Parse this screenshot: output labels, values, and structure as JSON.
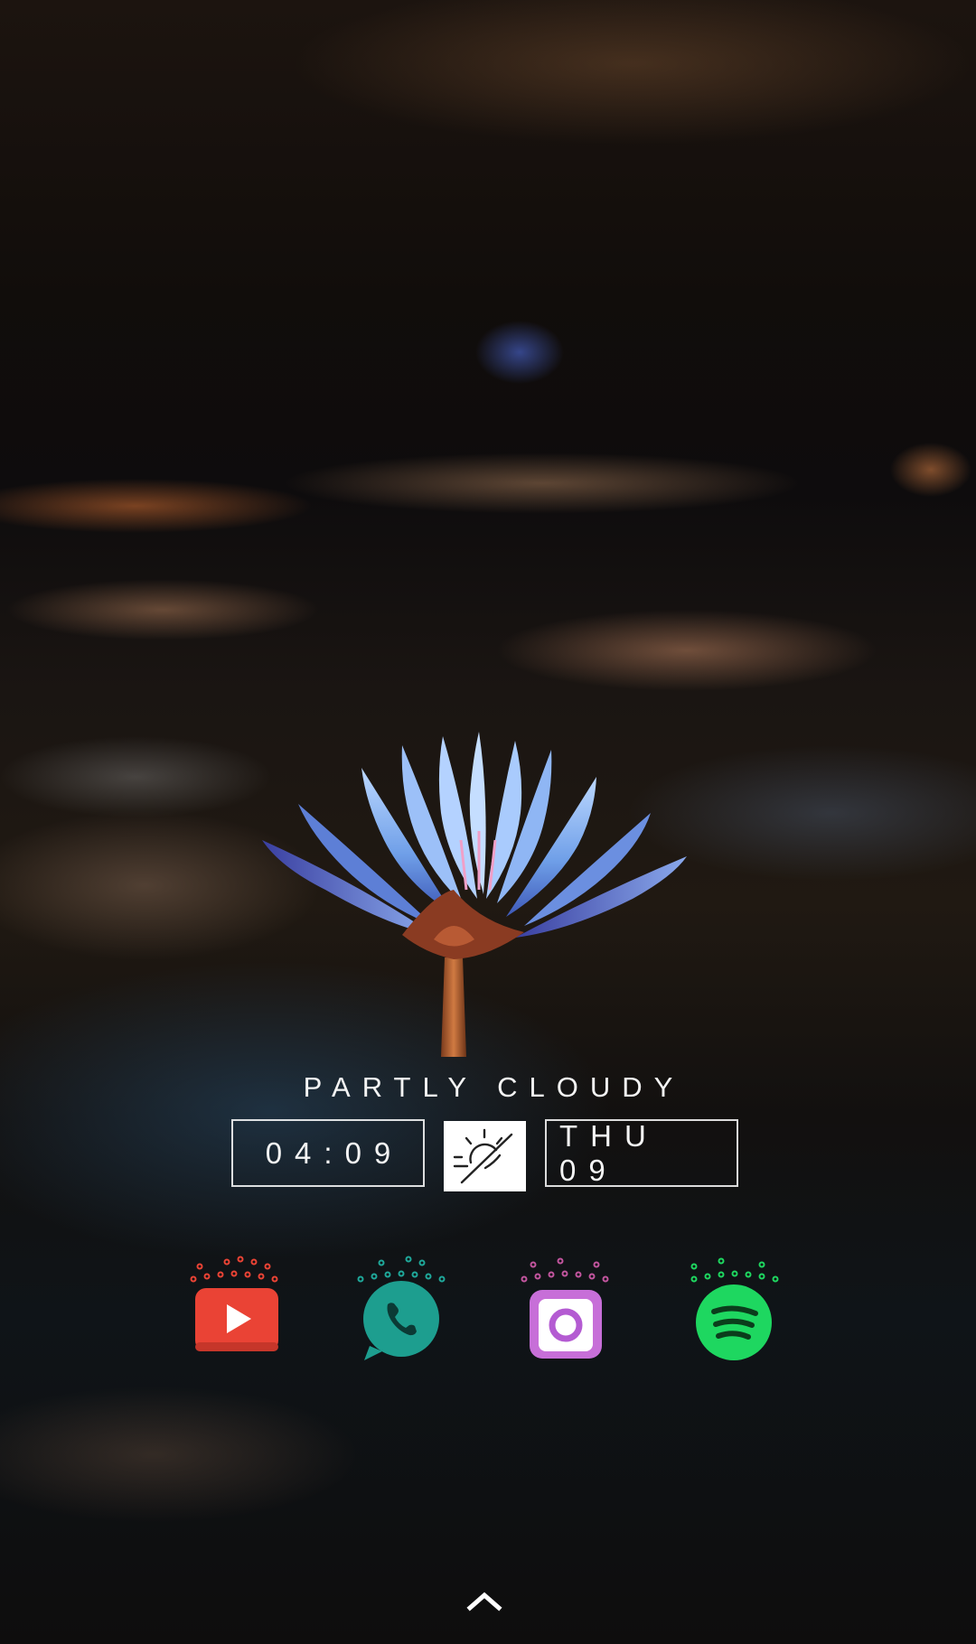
{
  "weather": {
    "condition": "PARTLY CLOUDY",
    "icon": "partly-cloudy-sun-icon"
  },
  "clock": {
    "time": "04:09",
    "date": "THU 09"
  },
  "dock": {
    "apps": [
      {
        "name": "YouTube",
        "icon": "youtube-icon",
        "color": "#ea4335"
      },
      {
        "name": "Phone",
        "icon": "phone-icon",
        "color": "#1fa89a"
      },
      {
        "name": "Instagram",
        "icon": "instagram-icon",
        "color": "#b45bd2"
      },
      {
        "name": "Spotify",
        "icon": "spotify-icon",
        "color": "#1ed760"
      }
    ]
  },
  "navigation": {
    "drawer_icon": "chevron-up-icon"
  },
  "wallpaper": {
    "subject": "lotus-flower",
    "accent_color": "#5a8fe0"
  }
}
